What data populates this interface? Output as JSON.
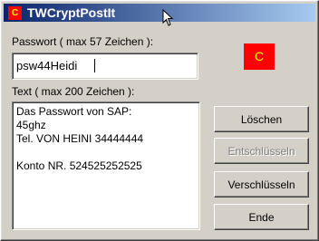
{
  "window": {
    "title": "TWCryptPostIt",
    "icon": "app-icon"
  },
  "logo": {
    "label": "C",
    "color": "#ff0000"
  },
  "password": {
    "label": "Passwort ( max 57 Zeichen ):",
    "value": "psw44Heidi"
  },
  "text": {
    "label": "Text ( max 200 Zeichen ):",
    "value": "Das Passwort von SAP:\n45ghz\nTel. VON HEINI 34444444\n\nKonto NR. 524525252525"
  },
  "buttons": {
    "delete": "Löschen",
    "decrypt": "Entschlüsseln",
    "encrypt": "Verschlüsseln",
    "end": "Ende"
  },
  "colors": {
    "titlebar_start": "#0a246a",
    "titlebar_end": "#a6caf0",
    "face": "#d4d0c8"
  }
}
